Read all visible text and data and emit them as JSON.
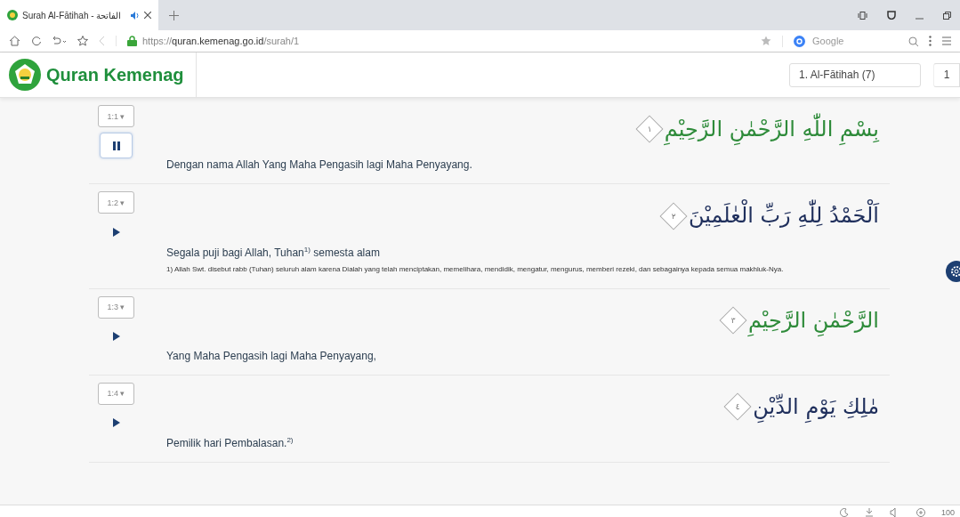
{
  "browser": {
    "tab": {
      "title": "Surah Al-Fātihah - الفاتحة",
      "audio": true
    },
    "url": {
      "secure": "https://",
      "host": "quran.kemenag.go.id",
      "path": "/surah/1"
    },
    "search_engine": "Google",
    "zoom": "100"
  },
  "header": {
    "brand": "Quran Kemenag",
    "surah_select": "1. Al-Fātihah (7)",
    "verse_select": "1"
  },
  "verses": [
    {
      "label": "1:1 ▾",
      "playing": true,
      "arabic": "بِسْمِ اللّٰهِ الرَّحْمٰنِ الرَّحِيْمِ",
      "number": "١",
      "color": "#2e8b3a",
      "translation": "Dengan nama Allah Yang Maha Pengasih lagi Maha Penyayang."
    },
    {
      "label": "1:2 ▾",
      "playing": false,
      "arabic": "اَلْحَمْدُ لِلّٰهِ رَبِّ الْعٰلَمِيْنَ",
      "number": "٢",
      "color": "#1f2f5c",
      "translation": "Segala puji bagi Allah, Tuhan$^{1)}$ semesta alam",
      "footnote": "1) Allah Swt. disebut rabb (Tuhan) seluruh alam karena Dialah yang telah menciptakan, memelihara, mendidik, mengatur, mengurus, memberi rezeki, dan sebagainya kepada semua makhluk-Nya."
    },
    {
      "label": "1:3 ▾",
      "playing": false,
      "arabic": "الرَّحْمٰنِ الرَّحِيْمِ",
      "number": "٣",
      "color": "#2e8b3a",
      "translation": "Yang Maha Pengasih lagi Maha Penyayang,"
    },
    {
      "label": "1:4 ▾",
      "playing": false,
      "arabic": "مٰلِكِ يَوْمِ الدِّيْنِ",
      "number": "٤",
      "color": "#1f2f5c",
      "translation": "Pemilik hari Pembalasan.$^{2)}$"
    }
  ]
}
